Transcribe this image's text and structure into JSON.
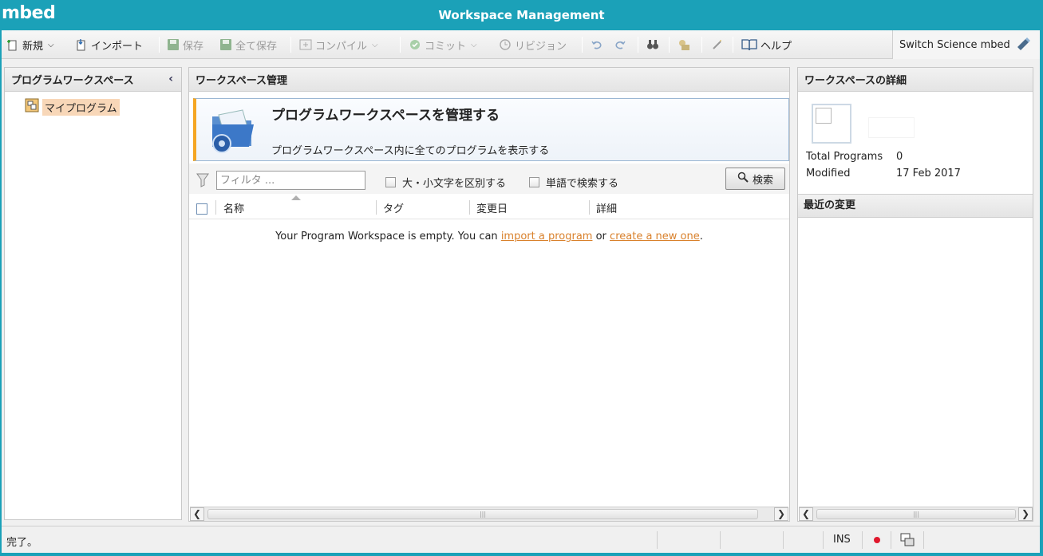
{
  "app": {
    "logo": "mbed",
    "window_title": "Workspace Management"
  },
  "toolbar": {
    "new_label": "新規",
    "import_label": "インポート",
    "save_label": "保存",
    "save_all_label": "全て保存",
    "compile_label": "コンパイル",
    "commit_label": "コミット",
    "revision_label": "リビジョン",
    "help_label": "ヘルプ",
    "platform_label": "Switch Science mbed L"
  },
  "left_panel": {
    "title": "プログラムワークスペース",
    "tree": [
      {
        "label": "マイプログラム"
      }
    ]
  },
  "center_panel": {
    "title": "ワークスペース管理",
    "banner": {
      "heading": "プログラムワークスペースを管理する",
      "subtitle": "プログラムワークスペース内に全てのプログラムを表示する"
    },
    "filter": {
      "placeholder": "フィルタ ...",
      "value": "",
      "case_sensitive_label": "大・小文字を区別する",
      "whole_word_label": "単語で検索する",
      "search_label": "検索"
    },
    "table": {
      "columns": [
        "名称",
        "タグ",
        "変更日",
        "詳細"
      ],
      "empty_prefix": "Your Program Workspace is empty. You can ",
      "import_link": "import a program",
      "or_text": " or ",
      "create_link": "create a new one",
      "empty_suffix": "."
    }
  },
  "right_panel": {
    "title": "ワークスペースの詳細",
    "total_programs_label": "Total Programs",
    "total_programs_value": "0",
    "modified_label": "Modified",
    "modified_value": "17 Feb 2017",
    "recent_changes_title": "最近の変更"
  },
  "statusbar": {
    "status": "完了。",
    "insert_mode": "INS"
  },
  "colors": {
    "titlebar": "#1ba1b8",
    "link": "#d9812c",
    "banner_accent": "#f5a623",
    "record": "#e0182d"
  }
}
